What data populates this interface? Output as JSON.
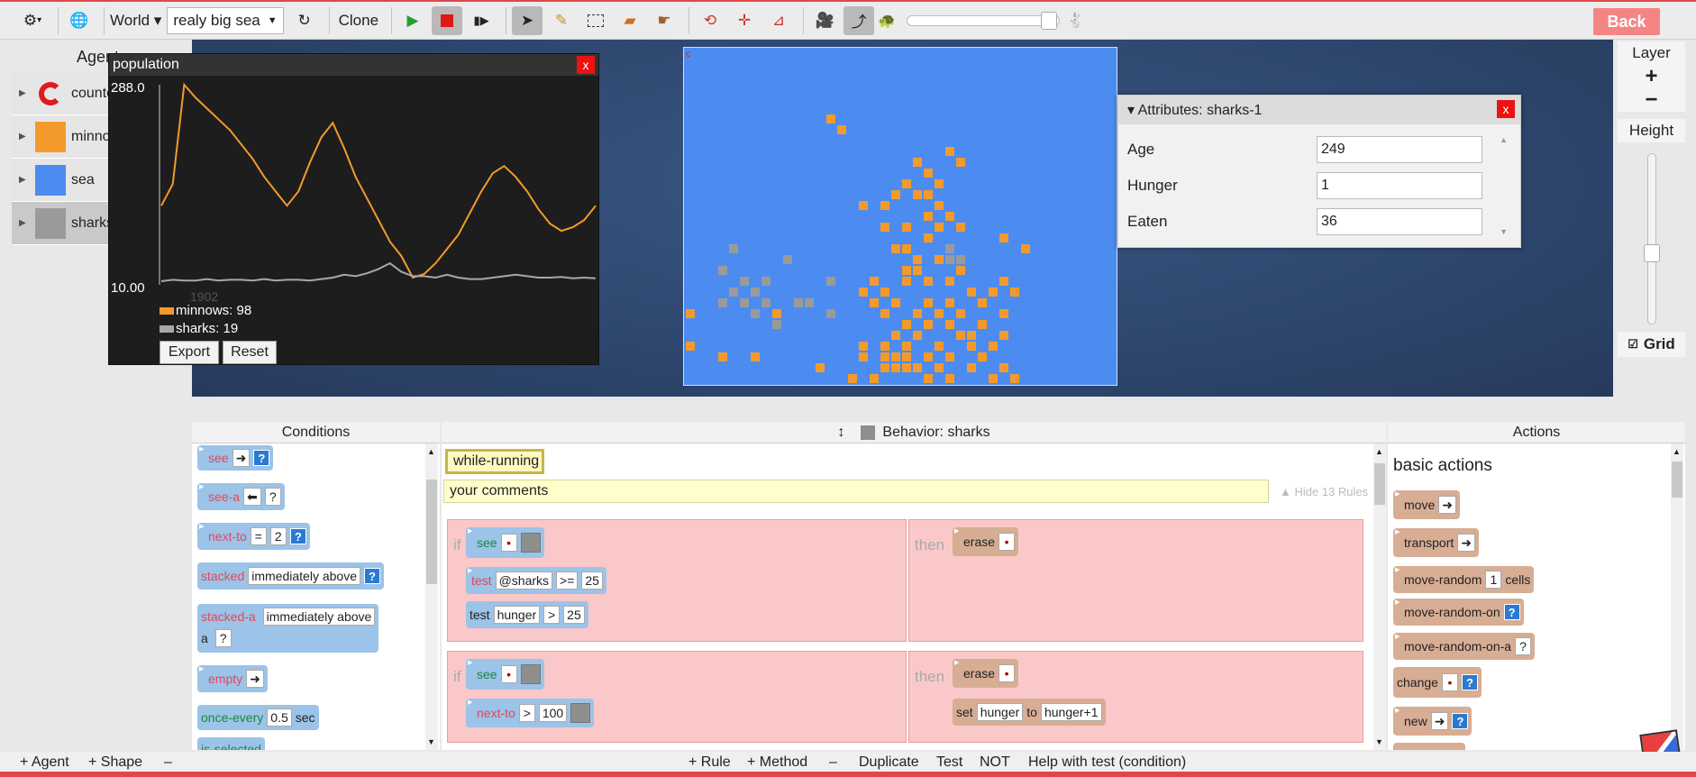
{
  "toolbar": {
    "world_label": "World ▾",
    "world_select": "realy big sea",
    "clone_label": "Clone",
    "back_label": "Back"
  },
  "gallery": {
    "title": "Agents",
    "items": [
      {
        "label": "counter",
        "color": "#e11b1b",
        "icon": "counter-icon"
      },
      {
        "label": "minnows",
        "color": "#f39a2b"
      },
      {
        "label": "sea",
        "color": "#4c8cf0"
      },
      {
        "label": "sharks",
        "color": "#9a9a9a"
      }
    ]
  },
  "population_window": {
    "title": "population",
    "close": "x",
    "y_max_label": "288.0",
    "y_min_label": "10.00",
    "x_label": "1902",
    "legend": [
      {
        "text": "minnows: 98",
        "color": "#f39a2b"
      },
      {
        "text": "sharks: 19",
        "color": "#a8a8a8"
      }
    ],
    "export_label": "Export",
    "reset_label": "Reset"
  },
  "chart_data": {
    "type": "line",
    "title": "population",
    "ylim": [
      10,
      288
    ],
    "x_last": 1902,
    "series": [
      {
        "name": "minnows",
        "color": "#f39a2b",
        "values": [
          120,
          150,
          288,
          270,
          255,
          240,
          225,
          205,
          185,
          160,
          140,
          120,
          140,
          180,
          215,
          235,
          200,
          160,
          130,
          100,
          70,
          50,
          20,
          25,
          40,
          60,
          80,
          110,
          140,
          165,
          175,
          160,
          140,
          115,
          95,
          85,
          90,
          100,
          120
        ]
      },
      {
        "name": "sharks",
        "color": "#a8a8a8",
        "values": [
          15,
          17,
          16,
          16,
          18,
          16,
          17,
          17,
          16,
          18,
          16,
          17,
          17,
          16,
          18,
          20,
          24,
          22,
          26,
          32,
          40,
          28,
          22,
          22,
          20,
          24,
          20,
          18,
          18,
          20,
          22,
          24,
          22,
          20,
          20,
          21,
          19,
          20,
          19
        ]
      }
    ]
  },
  "attributes": {
    "title": "▾ Attributes: sharks-1",
    "close": "x",
    "rows": [
      {
        "label": "Age",
        "value": "249"
      },
      {
        "label": "Hunger",
        "value": "1"
      },
      {
        "label": "Eaten",
        "value": "36"
      }
    ]
  },
  "right_panel": {
    "layer_label": "Layer",
    "plus": "+",
    "minus": "−",
    "height_label": "Height",
    "grid_label": "Grid"
  },
  "conditions": {
    "header": "Conditions",
    "tiles": {
      "see": "see",
      "see_a": "see-a",
      "see_a_q": "?",
      "next_to": "next-to",
      "next_to_op": "=",
      "next_to_val": "2",
      "stacked": "stacked",
      "stacked_val": "immediately above",
      "stacked_a": "stacked-a",
      "stacked_a_val": "immediately above",
      "stacked_a_a": "a",
      "stacked_a_q": "?",
      "empty": "empty",
      "once_every": "once-every",
      "once_every_val": "0.5",
      "once_every_unit": "sec",
      "is_selected": "is-selected"
    }
  },
  "behavior": {
    "header": "Behavior: sharks",
    "method": "while-running",
    "comment": "your comments",
    "hide_rules": "▲ Hide 13 Rules",
    "rules": [
      {
        "if": "if",
        "then": "then",
        "see": "see",
        "test1": "test",
        "test1_a": "@sharks",
        "test1_op": ">=",
        "test1_b": "25",
        "test2": "test",
        "test2_a": "hunger",
        "test2_op": ">",
        "test2_b": "25",
        "action": "erase"
      },
      {
        "if": "if",
        "then": "then",
        "see": "see",
        "next_to": "next-to",
        "next_to_op": ">",
        "next_to_val": "100",
        "action": "erase",
        "set": "set",
        "set_var": "hunger",
        "set_to": "to",
        "set_val": "hunger+1"
      }
    ]
  },
  "actions": {
    "header": "Actions",
    "section": "basic actions",
    "tiles": {
      "move": "move",
      "transport": "transport",
      "move_random": "move-random",
      "move_random_val": "1",
      "move_random_unit": "cells",
      "move_random_on": "move-random-on",
      "move_random_on_a": "move-random-on-a",
      "move_random_on_a_q": "?",
      "change": "change",
      "new": "new"
    }
  },
  "bottom_bar": {
    "add_agent": "+ Agent",
    "add_shape": "+ Shape",
    "remove": "–",
    "add_rule": "+ Rule",
    "add_method": "+ Method",
    "remove2": "–",
    "duplicate": "Duplicate",
    "test": "Test",
    "not": "NOT",
    "help": "Help with test (condition)"
  }
}
